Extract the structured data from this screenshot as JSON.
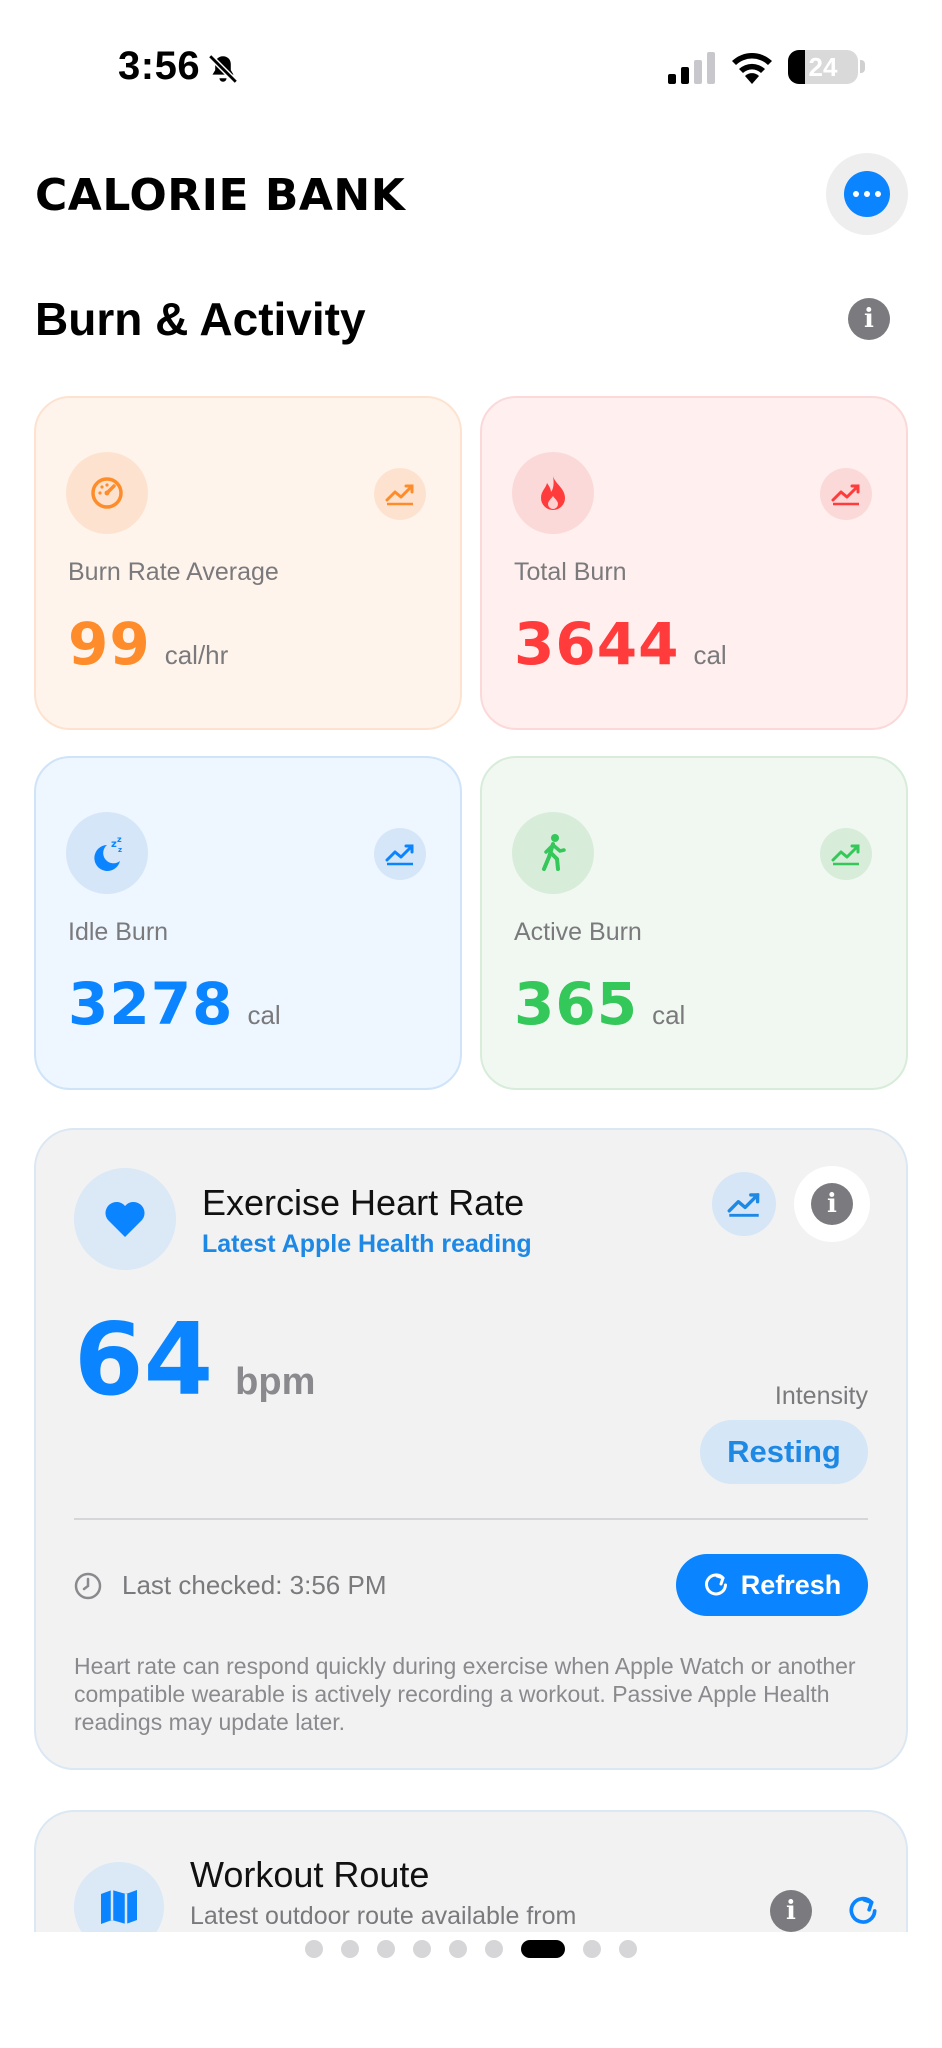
{
  "status_bar": {
    "time": "3:56",
    "battery": "24",
    "battery_level_percent": 24,
    "icons": [
      "bell-slash-icon",
      "signal-icon",
      "wifi-icon",
      "battery-icon"
    ]
  },
  "header": {
    "title": "CALORIE BANK",
    "menu_icon": "ellipsis-icon"
  },
  "section": {
    "title": "Burn & Activity",
    "info_icon": "info-icon"
  },
  "stats": [
    {
      "label": "Burn Rate Average",
      "value": "99",
      "unit": "cal/hr",
      "icon": "speedometer-icon",
      "color": "#ff8c2a"
    },
    {
      "label": "Total Burn",
      "value": "3644",
      "unit": "cal",
      "icon": "flame-icon",
      "color": "#ff3b3b"
    },
    {
      "label": "Idle Burn",
      "value": "3278",
      "unit": "cal",
      "icon": "moon-zzz-icon",
      "color": "#0a84ff"
    },
    {
      "label": "Active Burn",
      "value": "365",
      "unit": "cal",
      "icon": "walking-figure-icon",
      "color": "#34c759"
    }
  ],
  "heart_rate": {
    "title": "Exercise Heart Rate",
    "subtitle": "Latest Apple Health reading",
    "value": "64",
    "unit": "bpm",
    "intensity_label": "Intensity",
    "intensity_value": "Resting",
    "last_checked": "Last checked: 3:56 PM",
    "refresh_label": "Refresh",
    "note": "Heart rate can respond quickly during exercise when Apple Watch or another compatible wearable is actively recording a workout. Passive Apple Health readings may update later.",
    "accent": "#0a84ff"
  },
  "workout_route": {
    "title": "Workout Route",
    "subtitle": "Latest outdoor route available from"
  },
  "pager": {
    "total": 9,
    "active_index": 6
  }
}
